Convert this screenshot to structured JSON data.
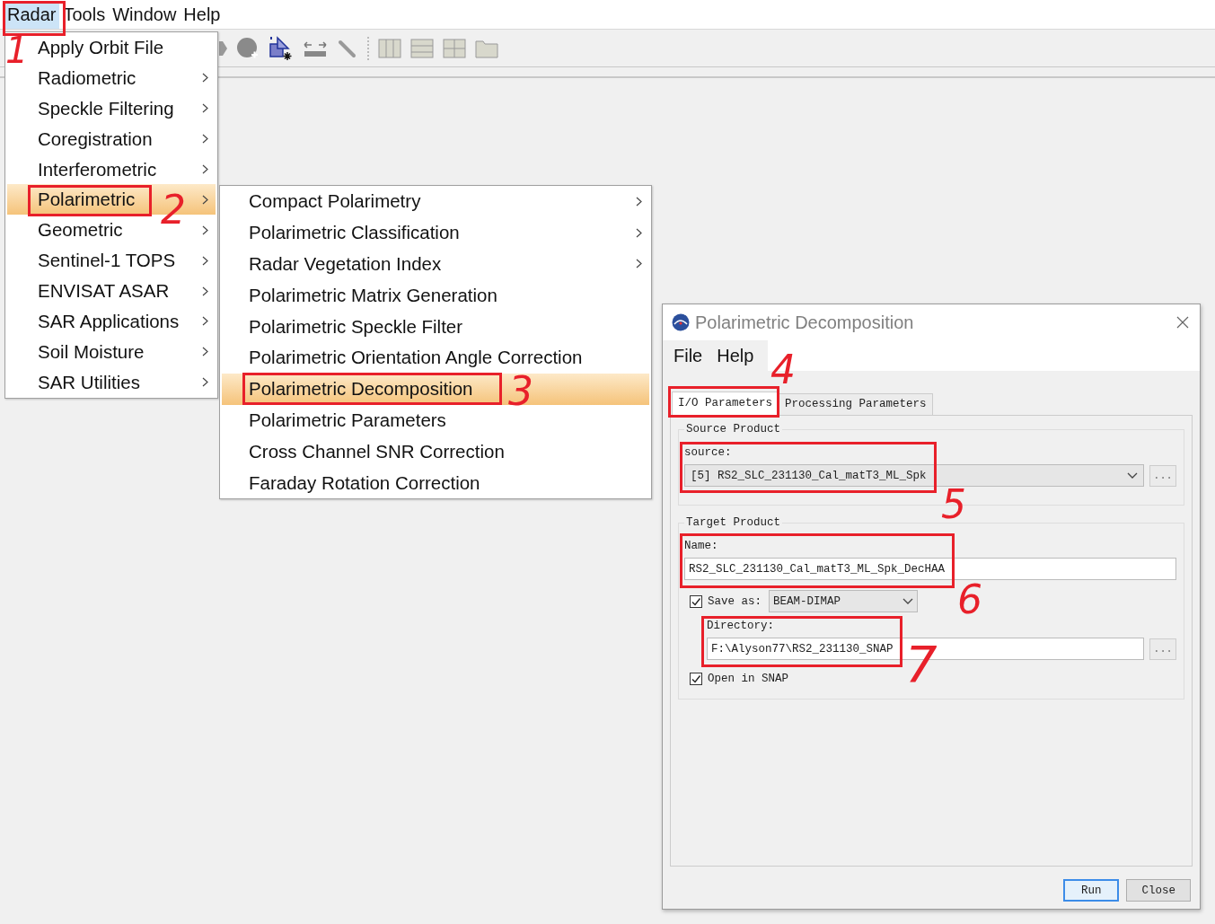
{
  "menubar": {
    "items": [
      {
        "label": "Radar",
        "selected": true
      },
      {
        "label": "Tools",
        "selected": false
      },
      {
        "label": "Window",
        "selected": false
      },
      {
        "label": "Help",
        "selected": false
      }
    ]
  },
  "radar_menu": {
    "items": [
      {
        "label": "Apply Orbit File",
        "submenu": false,
        "selected": false
      },
      {
        "label": "Radiometric",
        "submenu": true,
        "selected": false
      },
      {
        "label": "Speckle Filtering",
        "submenu": true,
        "selected": false
      },
      {
        "label": "Coregistration",
        "submenu": true,
        "selected": false
      },
      {
        "label": "Interferometric",
        "submenu": true,
        "selected": false
      },
      {
        "label": "Polarimetric",
        "submenu": true,
        "selected": true
      },
      {
        "label": "Geometric",
        "submenu": true,
        "selected": false
      },
      {
        "label": "Sentinel-1 TOPS",
        "submenu": true,
        "selected": false
      },
      {
        "label": "ENVISAT ASAR",
        "submenu": true,
        "selected": false
      },
      {
        "label": "SAR Applications",
        "submenu": true,
        "selected": false
      },
      {
        "label": "Soil Moisture",
        "submenu": true,
        "selected": false
      },
      {
        "label": "SAR Utilities",
        "submenu": true,
        "selected": false
      }
    ]
  },
  "polarimetric_submenu": {
    "items": [
      {
        "label": "Compact Polarimetry",
        "submenu": true,
        "selected": false
      },
      {
        "label": "Polarimetric Classification",
        "submenu": true,
        "selected": false
      },
      {
        "label": "Radar Vegetation Index",
        "submenu": true,
        "selected": false
      },
      {
        "label": "Polarimetric Matrix Generation",
        "submenu": false,
        "selected": false
      },
      {
        "label": "Polarimetric Speckle Filter",
        "submenu": false,
        "selected": false
      },
      {
        "label": "Polarimetric Orientation Angle Correction",
        "submenu": false,
        "selected": false
      },
      {
        "label": "Polarimetric Decomposition",
        "submenu": false,
        "selected": true
      },
      {
        "label": "Polarimetric Parameters",
        "submenu": false,
        "selected": false
      },
      {
        "label": "Cross Channel SNR Correction",
        "submenu": false,
        "selected": false
      },
      {
        "label": "Faraday Rotation Correction",
        "submenu": false,
        "selected": false
      }
    ]
  },
  "dialog": {
    "title": "Polarimetric Decomposition",
    "menu": [
      "File",
      "Help"
    ],
    "tabs": [
      {
        "label": "I/O Parameters",
        "selected": true
      },
      {
        "label": "Processing Parameters",
        "selected": false
      }
    ],
    "source_product": {
      "title": "Source Product",
      "label": "source:",
      "value": "[5] RS2_SLC_231130_Cal_matT3_ML_Spk",
      "browse": "..."
    },
    "target_product": {
      "title": "Target Product",
      "name_label": "Name:",
      "name_value": "RS2_SLC_231130_Cal_matT3_ML_Spk_DecHAA",
      "save_as": {
        "label": "Save as:",
        "checked": true,
        "format": "BEAM-DIMAP"
      },
      "directory_label": "Directory:",
      "directory_value": "F:\\Alyson77\\RS2_231130_SNAP",
      "browse": "...",
      "open_in_snap": {
        "label": "Open in SNAP",
        "checked": true
      }
    },
    "buttons": [
      {
        "label": "Run",
        "kind": "default"
      },
      {
        "label": "Close",
        "kind": "normal"
      }
    ]
  },
  "annotations": [
    {
      "label": "1"
    },
    {
      "label": "2"
    },
    {
      "label": "3"
    },
    {
      "label": "4"
    },
    {
      "label": "5"
    },
    {
      "label": "6"
    },
    {
      "label": "7"
    }
  ]
}
